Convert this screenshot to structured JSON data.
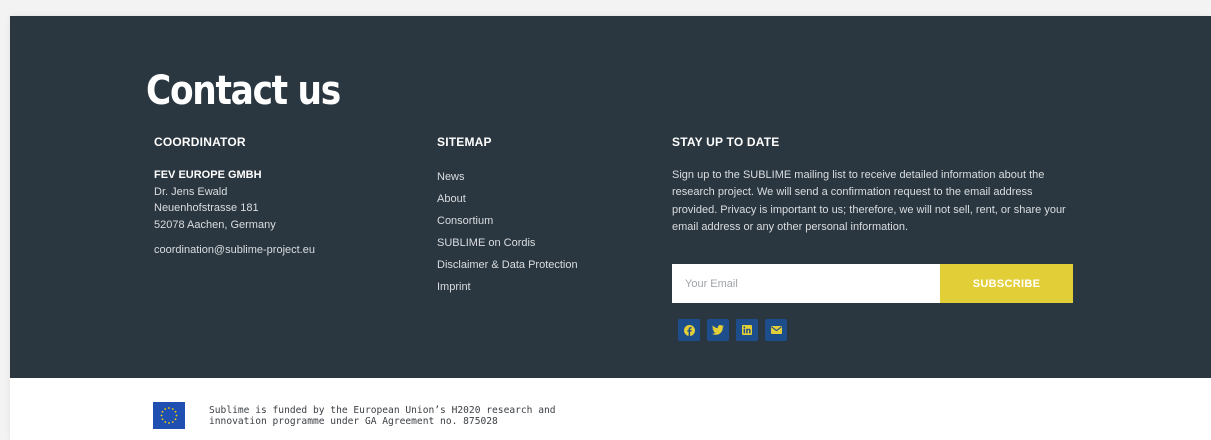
{
  "contact": {
    "title": "Contact us"
  },
  "coordinator": {
    "heading": "COORDINATOR",
    "company": "FEV EUROPE GMBH",
    "name": "Dr. Jens Ewald",
    "street": "Neuenhofstrasse 181",
    "city": "52078 Aachen, Germany",
    "email": "coordination@sublime-project.eu"
  },
  "sitemap": {
    "heading": "SITEMAP",
    "links": [
      {
        "label": "News"
      },
      {
        "label": "About"
      },
      {
        "label": "Consortium"
      },
      {
        "label": "SUBLIME on Cordis"
      },
      {
        "label": "Disclaimer & Data Protection"
      },
      {
        "label": "Imprint"
      }
    ]
  },
  "newsletter": {
    "heading": "STAY UP TO DATE",
    "text": "Sign up to the SUBLIME mailing list to receive detailed information about the research project. We will send a confirmation request to the email address provided. Privacy is important to us; therefore, we will not sell, rent, or share your email address or any other personal information.",
    "email_placeholder": "Your Email",
    "subscribe_label": "SUBSCRIBE"
  },
  "social": {
    "icons": [
      "facebook-icon",
      "twitter-icon",
      "linkedin-icon",
      "envelope-icon"
    ],
    "color": "#1e4d8c"
  },
  "funding": {
    "line1": "Sublime is funded by the European Union’s H2020 research and",
    "line2": "innovation programme under GA Agreement no. 875028"
  },
  "colors": {
    "footer_bg": "#2b3740",
    "accent": "#e2cf38",
    "eu_blue": "#1f4fb0"
  }
}
